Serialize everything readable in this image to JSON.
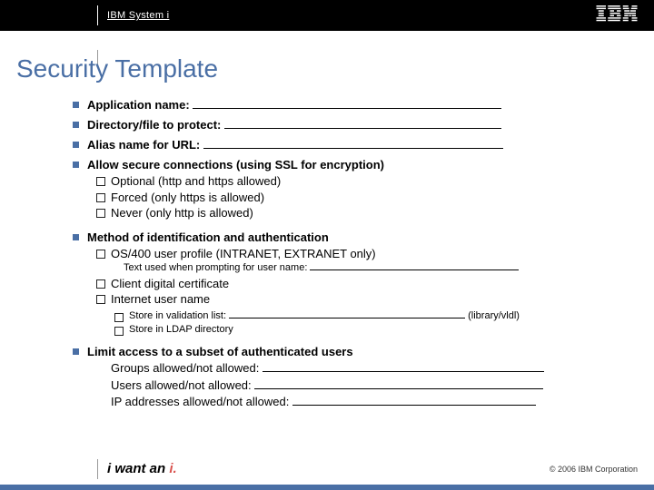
{
  "header": {
    "system": "IBM System i"
  },
  "title": "Security Template",
  "bullets": {
    "app_name": "Application name:",
    "dir_protect": "Directory/file to protect:",
    "alias": "Alias name for URL:",
    "ssl": {
      "heading": "Allow secure connections (using SSL for encryption)",
      "opt1": "Optional (http and https allowed)",
      "opt2": "Forced (only https is allowed)",
      "opt3": "Never (only http is allowed)"
    },
    "auth": {
      "heading": "Method of identification and authentication",
      "os400": "OS/400 user profile (INTRANET, EXTRANET only)",
      "os400_prompt": "Text used when prompting for user name:",
      "clientcert": "Client digital certificate",
      "inetuser": "Internet user name",
      "store_vldl": "Store in validation list:",
      "store_vldl_suffix": "(library/vldl)",
      "store_ldap": "Store in LDAP directory"
    },
    "limit": {
      "heading": "Limit access to a subset of authenticated users",
      "groups": "Groups allowed/not allowed:",
      "users": "Users allowed/not allowed:",
      "ips": "IP addresses allowed/not allowed:"
    }
  },
  "footer": {
    "slogan_pre": "i want an ",
    "slogan_em": "i.",
    "copyright": "© 2006 IBM Corporation"
  }
}
